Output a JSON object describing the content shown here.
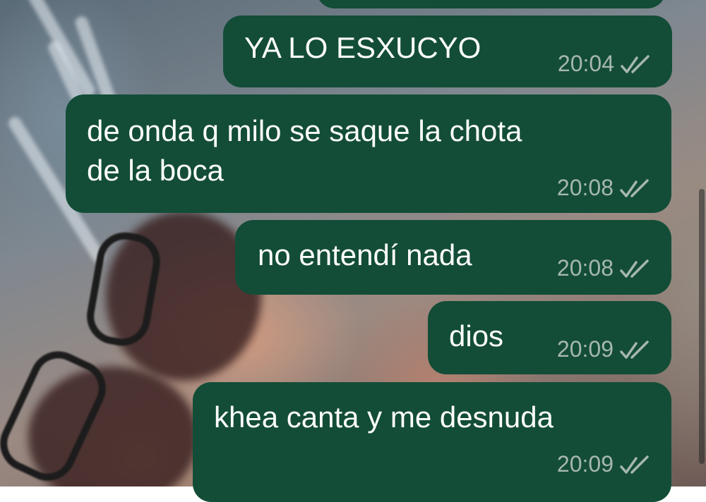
{
  "chat": {
    "messages": [
      {
        "text": "YA LO ESXUCYO",
        "time": "20:04",
        "status": "read-double-check-icon"
      },
      {
        "text": "de onda q milo se saque la chota\nde la boca",
        "time": "20:08",
        "status": "read-double-check-icon"
      },
      {
        "text": "no entendí nada",
        "time": "20:08",
        "status": "read-double-check-icon"
      },
      {
        "text": "dios",
        "time": "20:09",
        "status": "read-double-check-icon"
      },
      {
        "text": "khea canta y me desnuda",
        "time": "20:09",
        "status": "read-double-check-icon"
      }
    ]
  },
  "colors": {
    "bubble_outgoing": "#134d37",
    "message_text": "#ffffff",
    "meta_text": "#a6b7ae"
  }
}
